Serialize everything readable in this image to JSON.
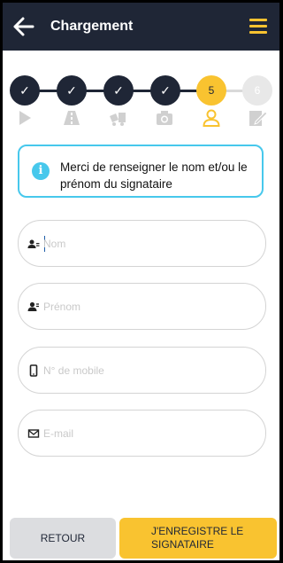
{
  "header": {
    "title": "Chargement",
    "back_icon": "arrow-left-icon",
    "menu_icon": "hamburger-menu-icon"
  },
  "stepper": {
    "steps": [
      {
        "label": "✓",
        "state": "done"
      },
      {
        "label": "✓",
        "state": "done"
      },
      {
        "label": "✓",
        "state": "done"
      },
      {
        "label": "✓",
        "state": "done"
      },
      {
        "label": "5",
        "state": "active"
      },
      {
        "label": "6",
        "state": "future"
      }
    ],
    "icons": [
      "play-icon",
      "road-icon",
      "truck-icon",
      "camera-icon",
      "user-icon",
      "signature-icon"
    ]
  },
  "info": {
    "icon": "info-icon",
    "text": "Merci de renseigner le nom et/ou le prénom du signataire"
  },
  "form": {
    "nom": {
      "placeholder": "Nom",
      "icon": "user-card-icon"
    },
    "prenom": {
      "placeholder": "Prénom",
      "icon": "user-icon"
    },
    "mobile": {
      "placeholder": "N° de mobile",
      "icon": "mobile-icon"
    },
    "email": {
      "placeholder": "E-mail",
      "icon": "envelope-icon"
    }
  },
  "buttons": {
    "retour": "RETOUR",
    "save": "J'ENREGISTRE LE SIGNATAIRE"
  },
  "colors": {
    "header_bg": "#1f2636",
    "accent": "#f9c330",
    "info_border": "#47c8ec"
  }
}
